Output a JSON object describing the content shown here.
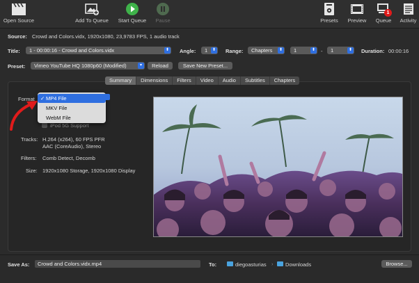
{
  "toolbar": {
    "open_source": "Open Source",
    "add_to_queue": "Add To Queue",
    "start_queue": "Start Queue",
    "pause": "Pause",
    "presets": "Presets",
    "preview": "Preview",
    "queue": "Queue",
    "queue_badge": "1",
    "activity": "Activity"
  },
  "source": {
    "label": "Source:",
    "value": "Crowd and Colors.vidx, 1920x1080, 23,9783 FPS, 1 audio track"
  },
  "title_row": {
    "title_label": "Title:",
    "title_value": "1 - 00:00:16 - Crowd and Colors.vidx",
    "angle_label": "Angle:",
    "angle_value": "1",
    "range_label": "Range:",
    "range_type": "Chapters",
    "range_start": "1",
    "range_sep": "-",
    "range_end": "1",
    "duration_label": "Duration:",
    "duration_value": "00:00:16"
  },
  "preset_row": {
    "preset_label": "Preset:",
    "preset_value": "Vimeo YouTube HQ 1080p60 (Modified)",
    "reload": "Reload",
    "save_new": "Save New Preset..."
  },
  "tabs": [
    "Summary",
    "Dimensions",
    "Filters",
    "Video",
    "Audio",
    "Subtitles",
    "Chapters"
  ],
  "summary": {
    "format_label": "Format",
    "format_menu": [
      "MP4 File",
      "MKV File",
      "WebM File"
    ],
    "ipod_partial": "iPod 5G Support",
    "tracks_label": "Tracks:",
    "tracks_line1": "H.264 (x264), 60 FPS PFR",
    "tracks_line2": "AAC (CoreAudio), Stereo",
    "filters_label": "Filters:",
    "filters_value": "Comb Detect, Decomb",
    "size_label": "Size:",
    "size_value": "1920x1080 Storage, 1920x1080 Display"
  },
  "save": {
    "save_as_label": "Save As:",
    "save_as_value": "Crowd and Colors.vidx.mp4",
    "to_label": "To:",
    "path_user": "diegoasturias",
    "path_sep": "›",
    "path_folder": "Downloads",
    "browse": "Browse..."
  },
  "colors": {
    "accent": "#2f6fe0",
    "play_green": "#3fb24a",
    "annotation_red": "#e01b1b"
  }
}
